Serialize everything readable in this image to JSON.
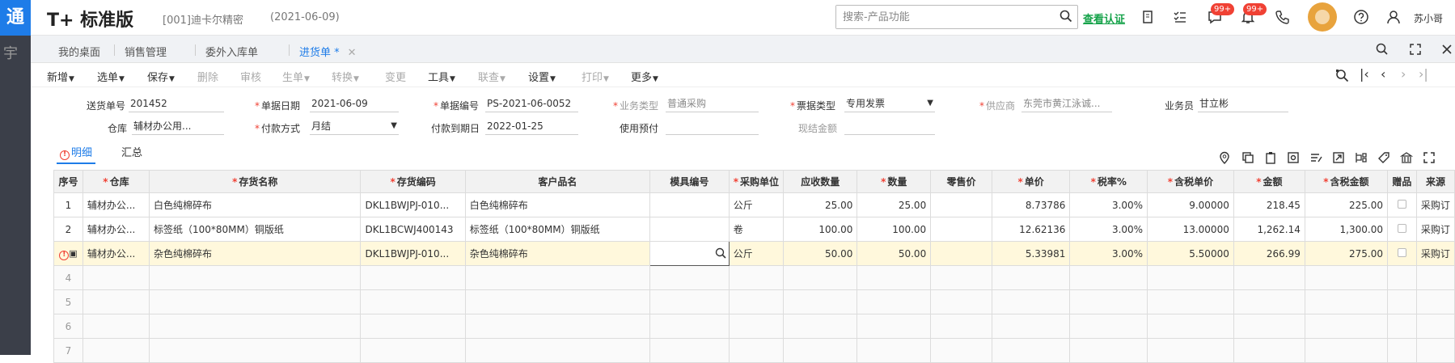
{
  "leftbar": {
    "logo": "通",
    "glyph": "宇"
  },
  "header": {
    "brand": "T+",
    "brand_suffix": "标准版",
    "company": "[001]迪卡尔精密",
    "date": "(2021-06-09)",
    "search_placeholder": "搜索-产品功能",
    "verify": "查看认证",
    "badge1": "99+",
    "badge2": "99+",
    "user": "苏小哥"
  },
  "tabs": [
    {
      "label": "我的桌面"
    },
    {
      "label": "销售管理"
    },
    {
      "label": "委外入库单"
    },
    {
      "label": "进货单 *"
    }
  ],
  "toolbar": {
    "new": "新增",
    "select": "选单",
    "save": "保存",
    "delete": "删除",
    "review": "审核",
    "generate": "生单",
    "convert": "转换",
    "change": "变更",
    "tools": "工具",
    "link": "联查",
    "settings": "设置",
    "print": "打印",
    "more": "更多"
  },
  "form": {
    "delivery_no_label": "送货单号",
    "delivery_no": "201452",
    "doc_date_label": "单据日期",
    "doc_date": "2021-06-09",
    "doc_no_label": "单据编号",
    "doc_no": "PS-2021-06-0052",
    "biz_type_label": "业务类型",
    "biz_type": "普通采购",
    "invoice_type_label": "票据类型",
    "invoice_type": "专用发票",
    "supplier_label": "供应商",
    "supplier": "东莞市黄江泳诚...",
    "salesman_label": "业务员",
    "salesman": "甘立彬",
    "warehouse_label": "仓库",
    "warehouse": "辅材办公用...",
    "payment_label": "付款方式",
    "payment": "月结",
    "due_date_label": "付款到期日",
    "due_date": "2022-01-25",
    "prepay_label": "使用预付",
    "prepay": "",
    "cash_label": "现结金额",
    "cash": ""
  },
  "subtabs": {
    "detail": "明细",
    "summary": "汇总"
  },
  "grid": {
    "columns": [
      {
        "label": "序号",
        "req": false
      },
      {
        "label": "仓库",
        "req": true
      },
      {
        "label": "存货名称",
        "req": true
      },
      {
        "label": "存货编码",
        "req": true
      },
      {
        "label": "客户品名",
        "req": false
      },
      {
        "label": "模具编号",
        "req": false
      },
      {
        "label": "采购单位",
        "req": true
      },
      {
        "label": "应收数量",
        "req": false
      },
      {
        "label": "数量",
        "req": true
      },
      {
        "label": "零售价",
        "req": false
      },
      {
        "label": "单价",
        "req": true
      },
      {
        "label": "税率%",
        "req": true
      },
      {
        "label": "含税单价",
        "req": true
      },
      {
        "label": "金额",
        "req": true
      },
      {
        "label": "含税金额",
        "req": true
      },
      {
        "label": "赠品",
        "req": false
      },
      {
        "label": "来源",
        "req": false
      }
    ],
    "rows": [
      {
        "no": "1",
        "wh": "辅材办公...",
        "name": "白色纯棉碎布",
        "code": "DKL1BWJPJ-010...",
        "cust": "白色纯棉碎布",
        "mold": "",
        "unit": "公斤",
        "recv": "25.00",
        "qty": "25.00",
        "retail": "",
        "price": "8.73786",
        "tax": "3.00%",
        "tprice": "9.00000",
        "amt": "218.45",
        "tamt": "225.00",
        "src": "采购订"
      },
      {
        "no": "2",
        "wh": "辅材办公...",
        "name": "标签纸（100*80MM）铜版纸",
        "code": "DKL1BCWJ400143",
        "cust": "标签纸（100*80MM）铜版纸",
        "mold": "",
        "unit": "卷",
        "recv": "100.00",
        "qty": "100.00",
        "retail": "",
        "price": "12.62136",
        "tax": "3.00%",
        "tprice": "13.00000",
        "amt": "1,262.14",
        "tamt": "1,300.00",
        "src": "采购订"
      },
      {
        "no": "",
        "wh": "辅材办公...",
        "name": "杂色纯棉碎布",
        "code": "DKL1BWJPJ-010...",
        "cust": "杂色纯棉碎布",
        "mold": "",
        "unit": "公斤",
        "recv": "50.00",
        "qty": "50.00",
        "retail": "",
        "price": "5.33981",
        "tax": "3.00%",
        "tprice": "5.50000",
        "amt": "266.99",
        "tamt": "275.00",
        "src": "采购订"
      }
    ],
    "empty_rows": [
      "4",
      "5",
      "6",
      "7"
    ]
  }
}
